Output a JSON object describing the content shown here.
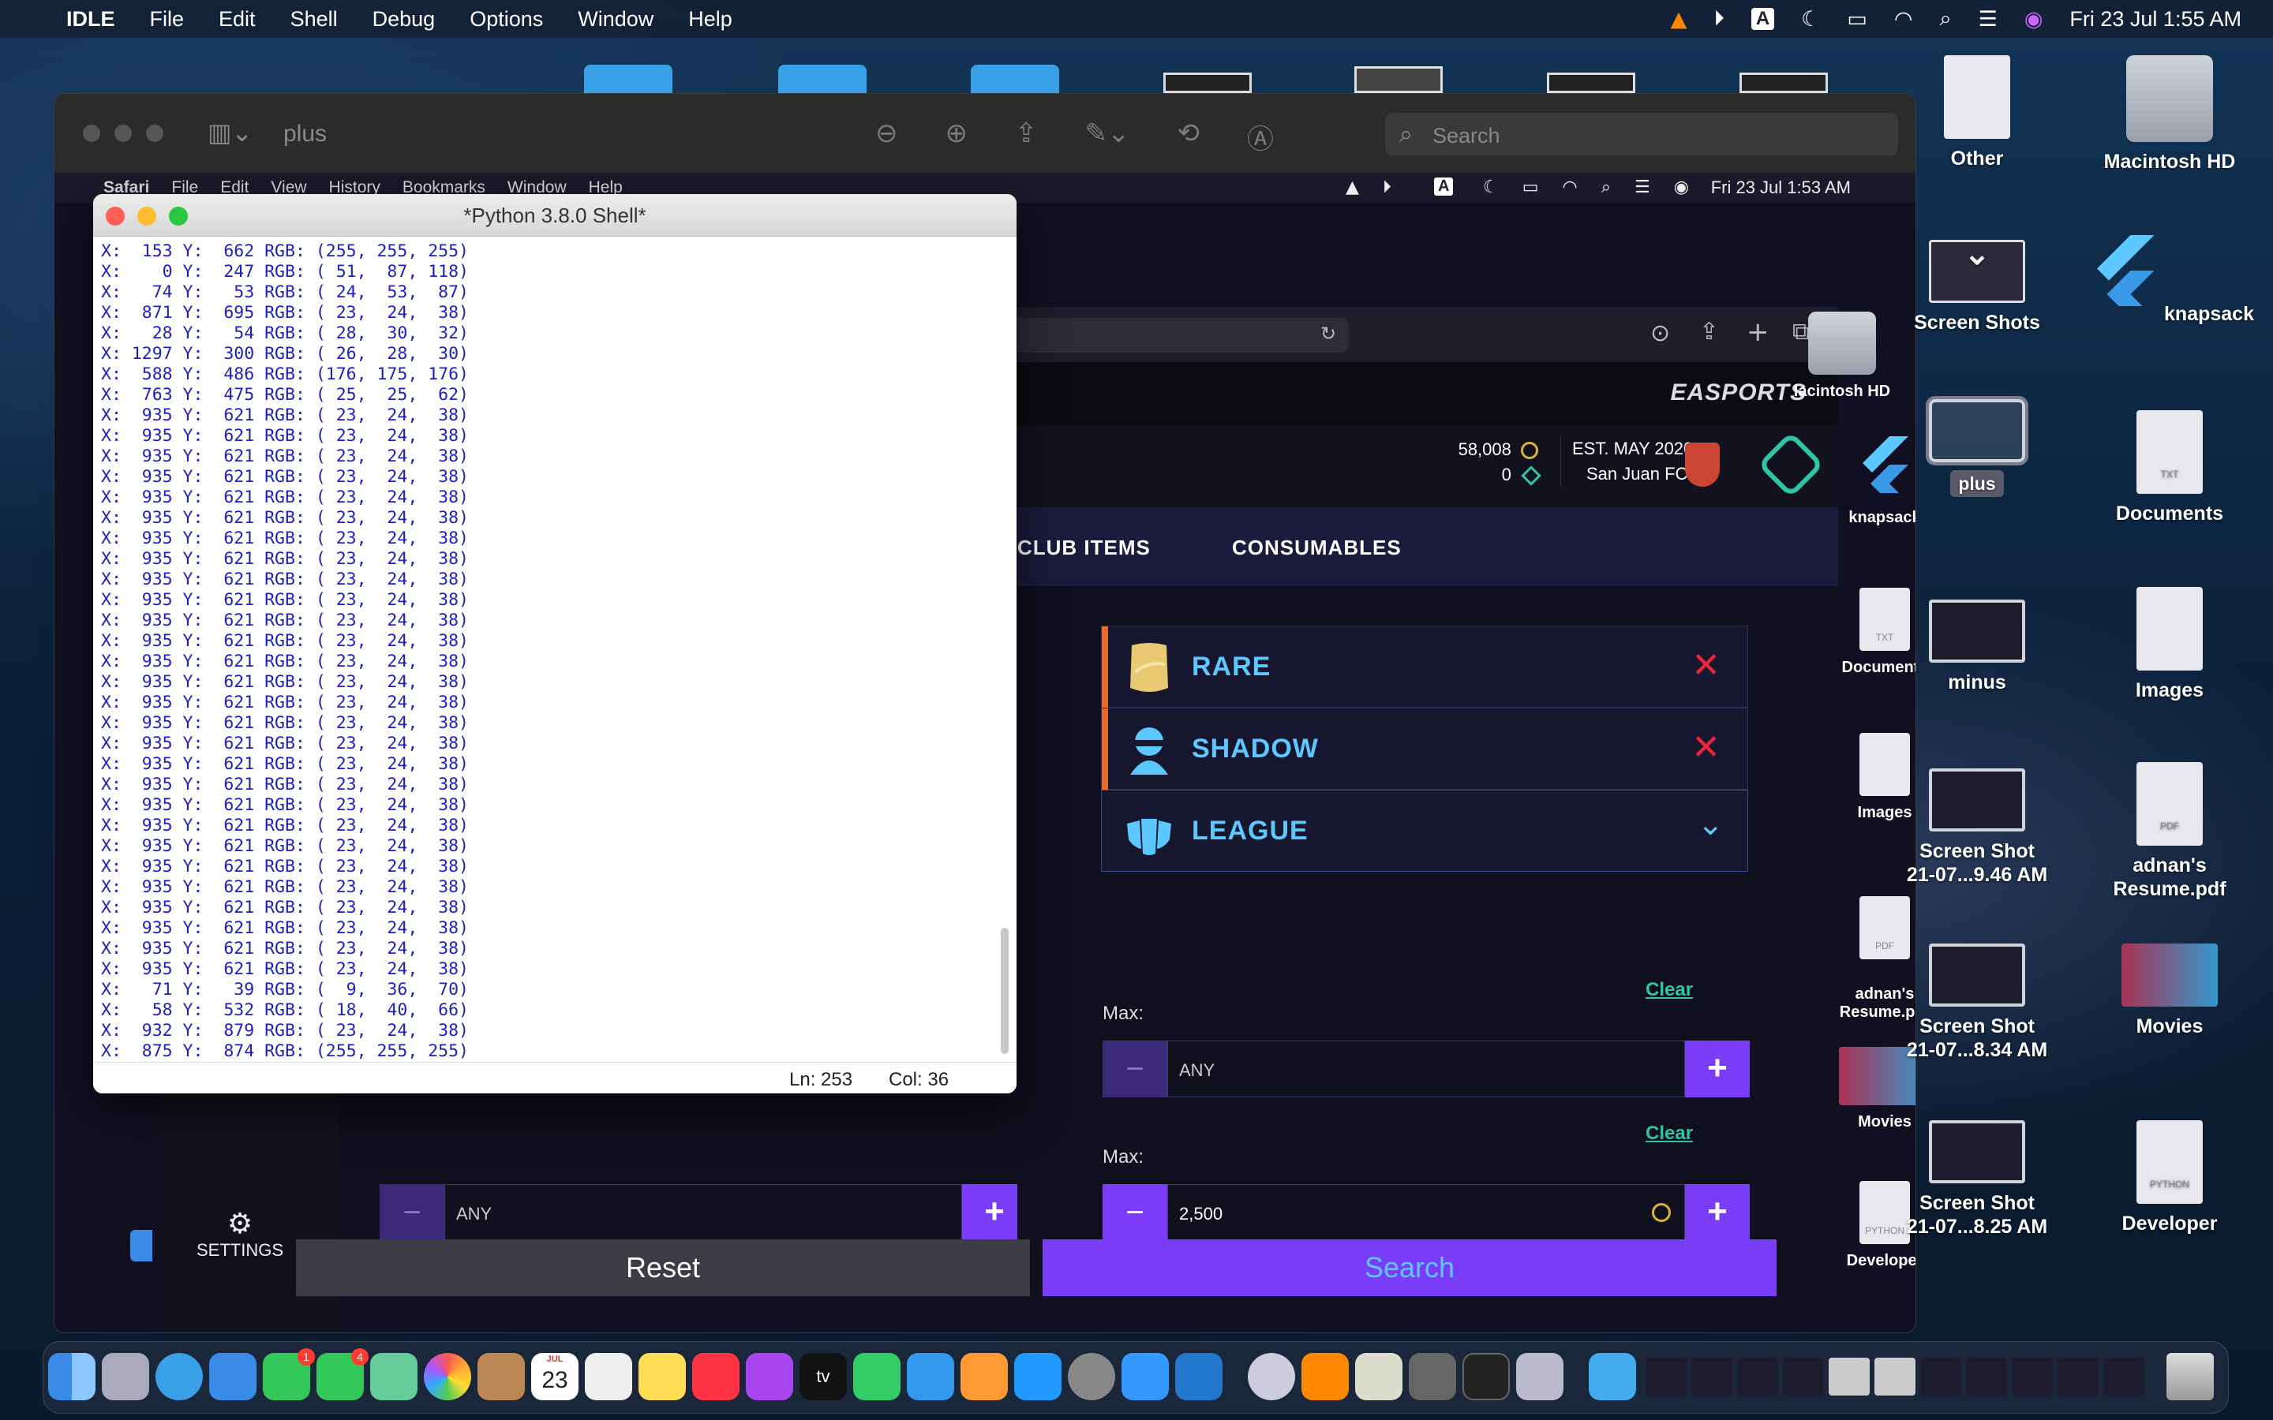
{
  "menubar": {
    "app": "IDLE",
    "items": [
      "File",
      "Edit",
      "Shell",
      "Debug",
      "Options",
      "Window",
      "Help"
    ],
    "clock": "Fri 23 Jul  1:55 AM",
    "input_badge": "A"
  },
  "preview_window": {
    "title": "plus",
    "search_placeholder": "Search"
  },
  "inner_menubar": {
    "app": "Safari",
    "items": [
      "File",
      "Edit",
      "View",
      "History",
      "Bookmarks",
      "Window",
      "Help"
    ],
    "clock": "Fri 23 Jul  1:53 AM",
    "input_badge": "A"
  },
  "fut": {
    "brand": "EASPORTS",
    "coins": "58,008",
    "points": "0",
    "est": "EST. MAY 2020",
    "club": "San Juan FC",
    "tabs": [
      "CLUB ITEMS",
      "CONSUMABLES"
    ],
    "filters": [
      {
        "label": "RARE",
        "action": "remove"
      },
      {
        "label": "SHADOW",
        "action": "remove"
      },
      {
        "label": "LEAGUE",
        "action": "expand"
      }
    ],
    "remove_glyph": "✕",
    "expand_glyph": "⌄",
    "bid": {
      "clear": "Clear",
      "max_label": "Max:",
      "max_value": "ANY"
    },
    "buy_now": {
      "clear": "Clear",
      "max_label": "Max:",
      "max_value": "2,500",
      "min_value": "ANY"
    },
    "minus": "−",
    "plus": "+",
    "reset": "Reset",
    "search": "Search",
    "settings": "SETTINGS"
  },
  "inner_desktop": {
    "icons": [
      {
        "label": "lacintosh HD",
        "kind": "disk"
      },
      {
        "label": "knapsack",
        "kind": "flutter"
      },
      {
        "label": "Documents",
        "kind": "doc",
        "tag": "TXT"
      },
      {
        "label": "Images",
        "kind": "doc",
        "tag": ""
      },
      {
        "label": "adnan's\nResume.pdf",
        "kind": "doc",
        "tag": "PDF"
      },
      {
        "label": "Movies",
        "kind": "thumb"
      },
      {
        "label": "Developer",
        "kind": "doc",
        "tag": "PYTHON"
      }
    ]
  },
  "idle": {
    "title": "*Python 3.8.0 Shell*",
    "lines": [
      "X:  153 Y:  662 RGB: (255, 255, 255)",
      "X:    0 Y:  247 RGB: ( 51,  87, 118)",
      "X:   74 Y:   53 RGB: ( 24,  53,  87)",
      "X:  871 Y:  695 RGB: ( 23,  24,  38)",
      "X:   28 Y:   54 RGB: ( 28,  30,  32)",
      "X: 1297 Y:  300 RGB: ( 26,  28,  30)",
      "X:  588 Y:  486 RGB: (176, 175, 176)",
      "X:  763 Y:  475 RGB: ( 25,  25,  62)",
      "X:  935 Y:  621 RGB: ( 23,  24,  38)",
      "X:  935 Y:  621 RGB: ( 23,  24,  38)",
      "X:  935 Y:  621 RGB: ( 23,  24,  38)",
      "X:  935 Y:  621 RGB: ( 23,  24,  38)",
      "X:  935 Y:  621 RGB: ( 23,  24,  38)",
      "X:  935 Y:  621 RGB: ( 23,  24,  38)",
      "X:  935 Y:  621 RGB: ( 23,  24,  38)",
      "X:  935 Y:  621 RGB: ( 23,  24,  38)",
      "X:  935 Y:  621 RGB: ( 23,  24,  38)",
      "X:  935 Y:  621 RGB: ( 23,  24,  38)",
      "X:  935 Y:  621 RGB: ( 23,  24,  38)",
      "X:  935 Y:  621 RGB: ( 23,  24,  38)",
      "X:  935 Y:  621 RGB: ( 23,  24,  38)",
      "X:  935 Y:  621 RGB: ( 23,  24,  38)",
      "X:  935 Y:  621 RGB: ( 23,  24,  38)",
      "X:  935 Y:  621 RGB: ( 23,  24,  38)",
      "X:  935 Y:  621 RGB: ( 23,  24,  38)",
      "X:  935 Y:  621 RGB: ( 23,  24,  38)",
      "X:  935 Y:  621 RGB: ( 23,  24,  38)",
      "X:  935 Y:  621 RGB: ( 23,  24,  38)",
      "X:  935 Y:  621 RGB: ( 23,  24,  38)",
      "X:  935 Y:  621 RGB: ( 23,  24,  38)",
      "X:  935 Y:  621 RGB: ( 23,  24,  38)",
      "X:  935 Y:  621 RGB: ( 23,  24,  38)",
      "X:  935 Y:  621 RGB: ( 23,  24,  38)",
      "X:  935 Y:  621 RGB: ( 23,  24,  38)",
      "X:  935 Y:  621 RGB: ( 23,  24,  38)",
      "X:  935 Y:  621 RGB: ( 23,  24,  38)",
      "X:   71 Y:   39 RGB: (  9,  36,  70)",
      "X:   58 Y:  532 RGB: ( 18,  40,  66)",
      "X:  932 Y:  879 RGB: ( 23,  24,  38)",
      "X:  875 Y:  874 RGB: (255, 255, 255)"
    ],
    "ln": "Ln: 253",
    "col": "Col: 36"
  },
  "desktop": {
    "icons": [
      {
        "label": "Other",
        "kind": "doc",
        "tag": ""
      },
      {
        "label": "Macintosh HD",
        "kind": "disk"
      },
      {
        "label": "Screen Shots",
        "kind": "folder-dark"
      },
      {
        "label": "knapsack",
        "kind": "flutter"
      },
      {
        "label": "plus",
        "kind": "thumb",
        "selected": true
      },
      {
        "label": "Documents",
        "kind": "doc",
        "tag": "TXT"
      },
      {
        "label": "minus",
        "kind": "thumb"
      },
      {
        "label": "Images",
        "kind": "doc",
        "tag": ""
      },
      {
        "label": "Screen Shot\n21-07...9.46 AM",
        "kind": "thumb"
      },
      {
        "label": "adnan's\nResume.pdf",
        "kind": "doc",
        "tag": "PDF"
      },
      {
        "label": "Screen Shot\n21-07...8.34 AM",
        "kind": "thumb"
      },
      {
        "label": "Movies",
        "kind": "thumb"
      },
      {
        "label": "Screen Shot\n21-07...8.25 AM",
        "kind": "thumb"
      },
      {
        "label": "Developer",
        "kind": "doc",
        "tag": "PYTHON"
      }
    ]
  },
  "dock": {
    "calendar_month": "JUL",
    "calendar_day": "23",
    "facetime_badge": "1",
    "messages_badge": "4",
    "tv_label": "tv"
  },
  "colors": {
    "accent_purple": "#7a3cf6",
    "fut_blue": "#5cc8ff",
    "remove_red": "#e9263a",
    "clear_teal": "#2ec4a8",
    "shell_text": "#1e1ec8"
  }
}
